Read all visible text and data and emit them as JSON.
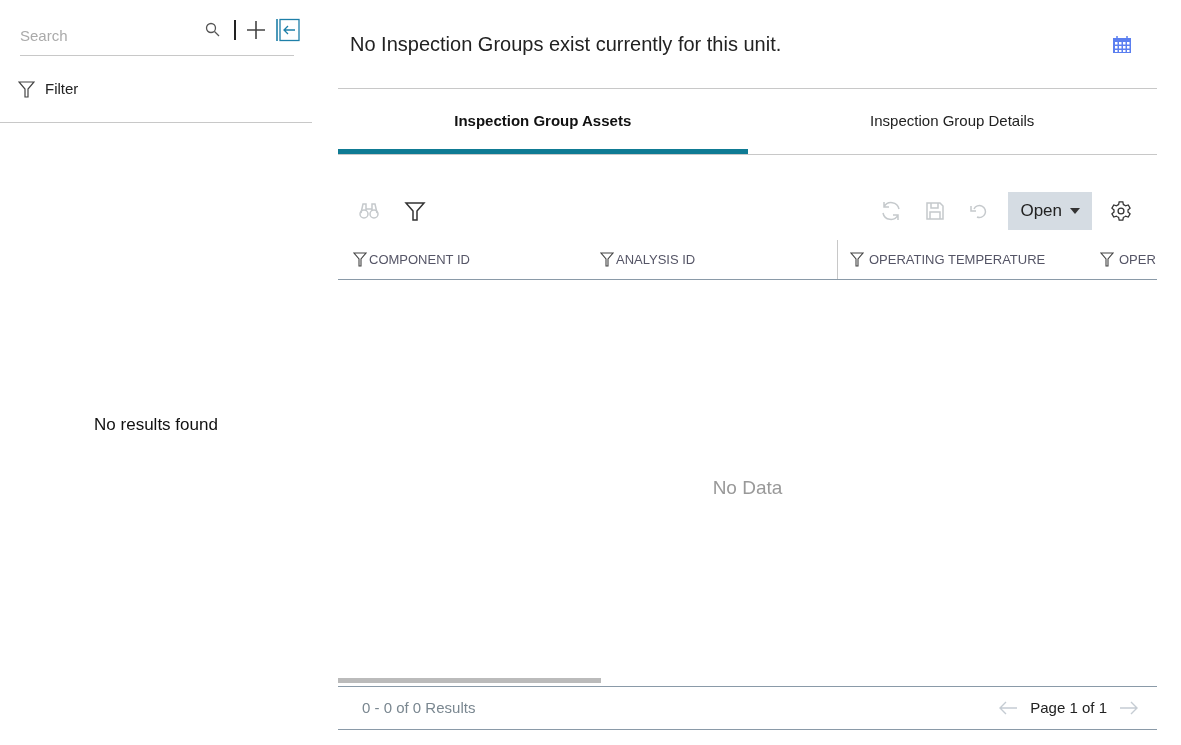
{
  "sidebar": {
    "search": {
      "placeholder": "Search"
    },
    "filter_label": "Filter",
    "empty_message": "No results found"
  },
  "header": {
    "title": "No Inspection Groups exist currently for this unit."
  },
  "tabs": [
    {
      "label": "Inspection Group Assets",
      "selected": true
    },
    {
      "label": "Inspection Group Details",
      "selected": false
    }
  ],
  "toolbar": {
    "left_tools": [
      {
        "kind": "binoculars",
        "disabled": true
      },
      {
        "kind": "filter",
        "disabled": false
      }
    ],
    "right_tools": [
      {
        "kind": "refresh",
        "disabled": true
      },
      {
        "kind": "save",
        "disabled": true
      },
      {
        "kind": "undo",
        "disabled": true
      }
    ],
    "open_button": "Open"
  },
  "table": {
    "columns": [
      "COMPONENT ID",
      "ANALYSIS ID",
      "OPERATING TEMPERATURE",
      "OPER"
    ],
    "empty_message": "No Data"
  },
  "footer": {
    "results": "0 - 0 of 0 Results",
    "page": "Page 1 of 1",
    "prev_disabled": true,
    "next_disabled": true
  }
}
